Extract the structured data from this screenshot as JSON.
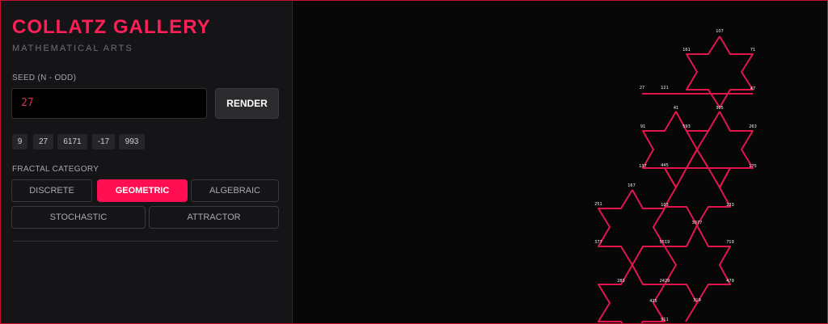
{
  "header": {
    "title": "COLLATZ GALLERY",
    "subtitle": "MATHEMATICAL ARTS"
  },
  "seed": {
    "label": "SEED (N - ODD)",
    "value": "27",
    "render_label": "RENDER"
  },
  "presets": [
    "9",
    "27",
    "6171",
    "-17",
    "993"
  ],
  "category": {
    "label": "FRACTAL CATEGORY",
    "options": [
      "DISCRETE",
      "GEOMETRIC",
      "ALGEBRAIC",
      "STOCHASTIC",
      "ATTRACTOR"
    ],
    "selected": "GEOMETRIC"
  },
  "fractal": {
    "stroke_color": "#e0164d",
    "node_labels": [
      "107",
      "161",
      "71",
      "27",
      "121",
      "47",
      "41",
      "305",
      "91",
      "593",
      "263",
      "137",
      "445",
      "175",
      "167",
      "251",
      "103",
      "233",
      "3077",
      "377",
      "5519",
      "719",
      "283",
      "2429",
      "479",
      "425",
      "319",
      "911"
    ]
  }
}
